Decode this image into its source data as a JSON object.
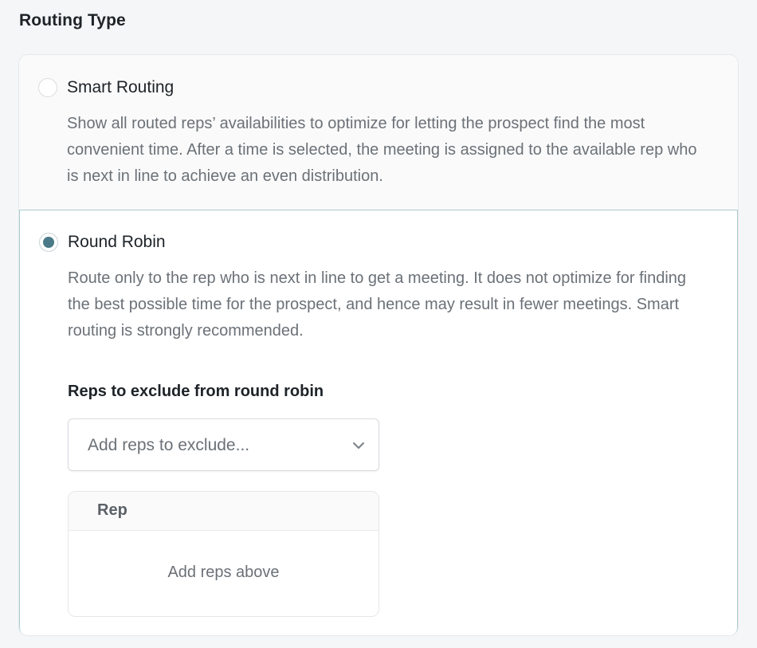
{
  "section": {
    "title": "Routing Type"
  },
  "options": [
    {
      "label": "Smart Routing",
      "description": "Show all routed reps’ availabilities to optimize for letting the prospect find the most convenient time. After a time is selected, the meeting is assigned to the available rep who is next in line to achieve an even distribution.",
      "selected": false
    },
    {
      "label": "Round Robin",
      "description": "Route only to the rep who is next in line to get a meeting. It does not optimize for finding the best possible time for the prospect, and hence may result in fewer meetings. Smart routing is strongly recommended.",
      "selected": true
    }
  ],
  "exclude": {
    "label": "Reps to exclude from round robin",
    "placeholder": "Add reps to exclude...",
    "icon": "chevron-down-icon"
  },
  "rep_table": {
    "columns": [
      "Rep"
    ],
    "empty_text": "Add reps above"
  },
  "colors": {
    "accent": "#4a7a88",
    "selected_border": "#a9ccd2"
  }
}
